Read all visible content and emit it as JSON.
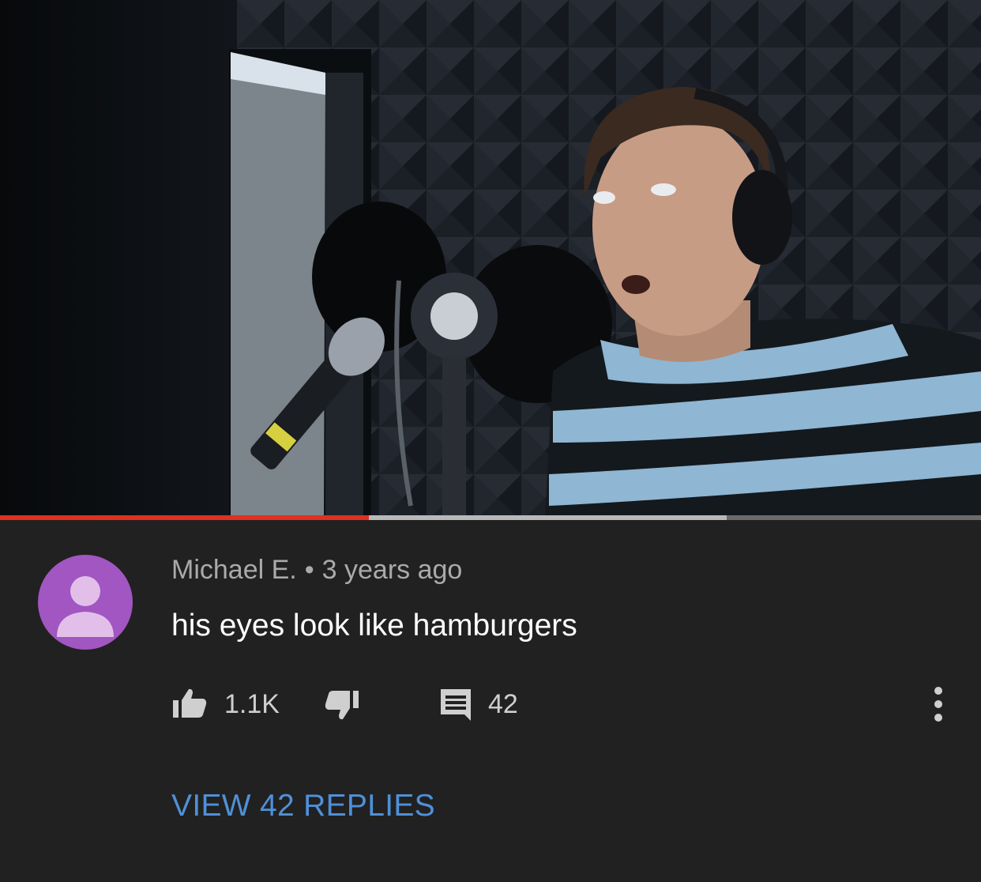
{
  "video": {
    "progress_played": 0.376,
    "progress_buffered": 0.741,
    "progress_colors": {
      "played": "#e1301f",
      "buffered": "#b9b9b9",
      "track": "#6b6b6b"
    }
  },
  "comment": {
    "author": "Michael E.",
    "separator": "•",
    "timestamp": "3 years ago",
    "text": "his eyes look like hamburgers",
    "likes": "1.1K",
    "reply_count": "42",
    "view_replies_label": "VIEW 42 REPLIES",
    "avatar": {
      "icon": "default-user-icon",
      "bg_color": "#a156c2",
      "fg_color": "#e2bfe8"
    }
  },
  "icons": {
    "like": "thumbs-up-icon",
    "dislike": "thumbs-down-icon",
    "reply": "comment-icon",
    "more": "more-vertical-icon"
  },
  "colors": {
    "background": "#212121",
    "link": "#4f90d8",
    "secondary_text": "#aaaaaa"
  }
}
